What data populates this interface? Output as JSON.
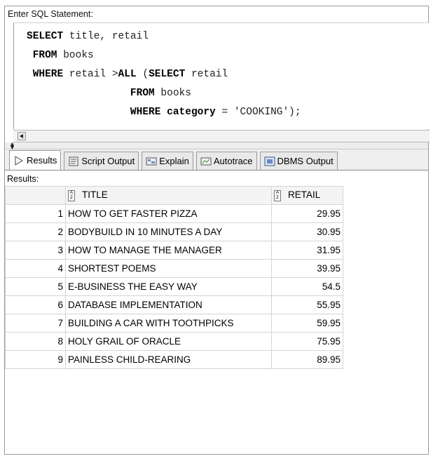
{
  "editor": {
    "label": "Enter SQL Statement:",
    "lines": [
      [
        {
          "t": "SELECT",
          "kw": true
        },
        {
          "t": " title, retail",
          "kw": false
        }
      ],
      [
        {
          "t": " FROM",
          "kw": true
        },
        {
          "t": " books",
          "kw": false
        }
      ],
      [
        {
          "t": " WHERE",
          "kw": true
        },
        {
          "t": " retail >",
          "kw": false
        },
        {
          "t": "ALL",
          "kw": true
        },
        {
          "t": " (",
          "kw": false
        },
        {
          "t": "SELECT",
          "kw": true
        },
        {
          "t": " retail",
          "kw": false
        }
      ],
      [
        {
          "t": "                 FROM",
          "kw": true
        },
        {
          "t": " books",
          "kw": false
        }
      ],
      [
        {
          "t": "                 WHERE category",
          "kw": true
        },
        {
          "t": " = 'COOKING');",
          "kw": false
        }
      ]
    ]
  },
  "tabs": [
    {
      "label": "Results",
      "icon": "play-icon",
      "active": true
    },
    {
      "label": "Script Output",
      "icon": "script-icon",
      "active": false
    },
    {
      "label": "Explain",
      "icon": "explain-icon",
      "active": false
    },
    {
      "label": "Autotrace",
      "icon": "autotrace-icon",
      "active": false
    },
    {
      "label": "DBMS Output",
      "icon": "dbms-icon",
      "active": false
    }
  ],
  "results": {
    "label": "Results:",
    "columns": [
      "TITLE",
      "RETAIL"
    ],
    "rows": [
      {
        "n": "1",
        "title": "HOW TO GET FASTER PIZZA",
        "retail": "29.95"
      },
      {
        "n": "2",
        "title": "BODYBUILD IN 10 MINUTES A DAY",
        "retail": "30.95"
      },
      {
        "n": "3",
        "title": "HOW TO MANAGE THE MANAGER",
        "retail": "31.95"
      },
      {
        "n": "4",
        "title": "SHORTEST POEMS",
        "retail": "39.95"
      },
      {
        "n": "5",
        "title": "E-BUSINESS THE EASY WAY",
        "retail": "54.5"
      },
      {
        "n": "6",
        "title": "DATABASE IMPLEMENTATION",
        "retail": "55.95"
      },
      {
        "n": "7",
        "title": "BUILDING A CAR WITH TOOTHPICKS",
        "retail": "59.95"
      },
      {
        "n": "8",
        "title": "HOLY GRAIL OF ORACLE",
        "retail": "75.95"
      },
      {
        "n": "9",
        "title": "PAINLESS CHILD-REARING",
        "retail": "89.95"
      }
    ]
  }
}
